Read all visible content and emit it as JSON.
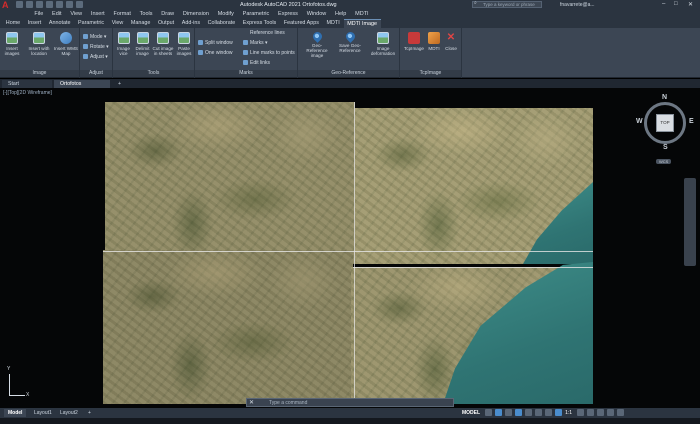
{
  "titlebar": {
    "app_logo": "A",
    "title": "Autodesk AutoCAD 2021   Ortofotos.dwg",
    "search_placeholder": "Type a keyword or phrase",
    "user": "fnavarrete@a...",
    "minimize": "–",
    "maximize": "□",
    "close": "✕"
  },
  "menubar": [
    "File",
    "Edit",
    "View",
    "Insert",
    "Format",
    "Tools",
    "Draw",
    "Dimension",
    "Modify",
    "Parametric",
    "Express",
    "Window",
    "Help",
    "MDTI"
  ],
  "ribbon_tabs": {
    "items": [
      "Home",
      "Insert",
      "Annotate",
      "Parametric",
      "View",
      "Manage",
      "Output",
      "Add-ins",
      "Collaborate",
      "Express Tools",
      "Featured Apps",
      "MDTI",
      "MDTI Image"
    ],
    "active_index": 12
  },
  "ribbon": {
    "image": {
      "label": "Image",
      "insert_images": "Insert images",
      "insert_with_location": "Insert with location",
      "insert_wms_map": "Insert WMS Map"
    },
    "adjust": {
      "label": "Adjust",
      "mode": "Mode",
      "rotate": "Rotate",
      "adjust": "Adjust"
    },
    "tools": {
      "label": "Tools",
      "image_vice": "Image vice",
      "delimit_image": "Delimit image",
      "cut_image_in_sheets": "Cut image in sheets",
      "paste_images": "Paste images"
    },
    "marks": {
      "label": "Marks",
      "reference_lines": "Reference lines",
      "split_window": "Split window",
      "one_window": "One window",
      "marks": "Marks",
      "line_marks_to_points": "Line marks to points",
      "edit_links": "Edit links"
    },
    "georef": {
      "label": "Geo-Reference",
      "geo_reference_image": "Geo-Reference image",
      "save_geo_reference": "Save Geo-Reference",
      "image_deformation": "Image deformation"
    },
    "tcpimage": {
      "label": "TcpImage",
      "tcpimage": "TcpImage",
      "mdti": "MDTI",
      "close": "Close"
    }
  },
  "file_tabs": {
    "start": "Start",
    "document": "Ortofotos",
    "add": "+"
  },
  "viewport": {
    "label": "[-][Top][2D Wireframe]"
  },
  "viewcube": {
    "face": "TOP",
    "north": "N",
    "south": "S",
    "east": "E",
    "west": "W",
    "wcs": "WCS"
  },
  "ucs": {
    "x": "X",
    "y": "Y"
  },
  "command_line": {
    "close": "✕",
    "prompt": "Type a command"
  },
  "statusbar": {
    "tabs": [
      "Model",
      "Layout1",
      "Layout2"
    ],
    "active_index": 0,
    "add": "+",
    "mode": "MODEL",
    "scale": "1:1"
  },
  "colors": {
    "titlebar": "#2b3440",
    "ribbon": "#3c4654",
    "viewport": "#050607",
    "sea": "#2f7473",
    "accent": "#4a8ccc",
    "logo_red": "#d52b2b"
  }
}
